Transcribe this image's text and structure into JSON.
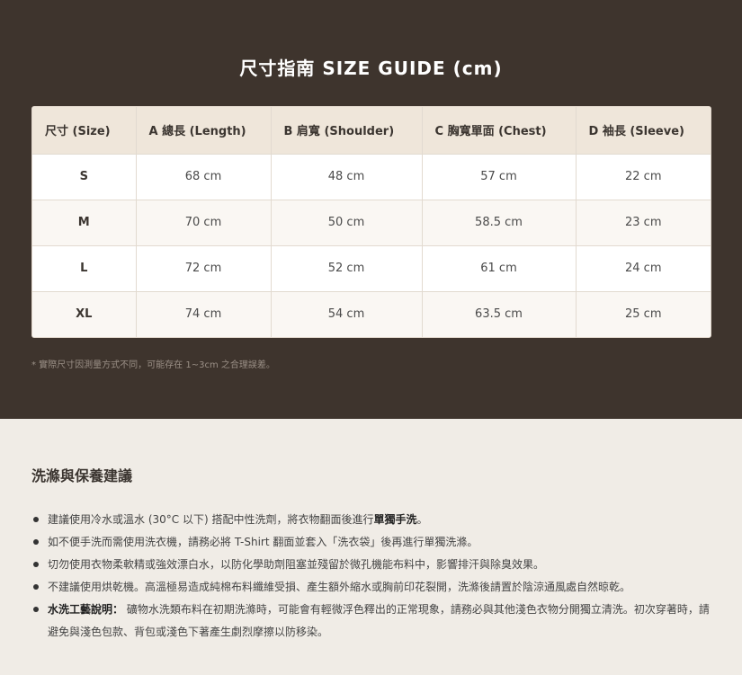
{
  "title": "尺寸指南 SIZE GUIDE (cm)",
  "table": {
    "headers": [
      "尺寸 (Size)",
      "A 總長 (Length)",
      "B 肩寬 (Shoulder)",
      "C 胸寬單面 (Chest)",
      "D 袖長 (Sleeve)"
    ],
    "rows": [
      [
        "S",
        "68 cm",
        "48 cm",
        "57 cm",
        "22 cm"
      ],
      [
        "M",
        "70 cm",
        "50 cm",
        "58.5 cm",
        "23 cm"
      ],
      [
        "L",
        "72 cm",
        "52 cm",
        "61 cm",
        "24 cm"
      ],
      [
        "XL",
        "74 cm",
        "54 cm",
        "63.5 cm",
        "25 cm"
      ]
    ]
  },
  "note": "* 實際尺寸因測量方式不同，可能存在 1~3cm 之合理誤差。",
  "care": {
    "title": "洗滌與保養建議",
    "items": [
      {
        "pre": "建議使用冷水或溫水 (30°C 以下) 搭配中性洗劑，將衣物翻面後進行",
        "bold": "單獨手洗",
        "post": "。"
      },
      {
        "pre": "如不便手洗而需使用洗衣機，請務必將 T-Shirt 翻面並套入「洗衣袋」後再進行單獨洗滌。",
        "bold": "",
        "post": ""
      },
      {
        "pre": "切勿使用衣物柔軟精或強效漂白水，以防化學助劑阻塞並殘留於微孔機能布料中，影響排汗與除臭效果。",
        "bold": "",
        "post": ""
      },
      {
        "pre": "不建議使用烘乾機。高溫極易造成純棉布料纖維受損、產生額外縮水或胸前印花裂開，洗滌後請置於陰涼通風處自然晾乾。",
        "bold": "",
        "post": ""
      },
      {
        "pre": "",
        "bold": "水洗工藝說明：",
        "post": " 礦物水洗類布料在初期洗滌時，可能會有輕微浮色釋出的正常現象，請務必與其他淺色衣物分開獨立清洗。初次穿著時，請避免與淺色包款、背包或淺色下著產生劇烈摩擦以防移染。"
      }
    ]
  }
}
